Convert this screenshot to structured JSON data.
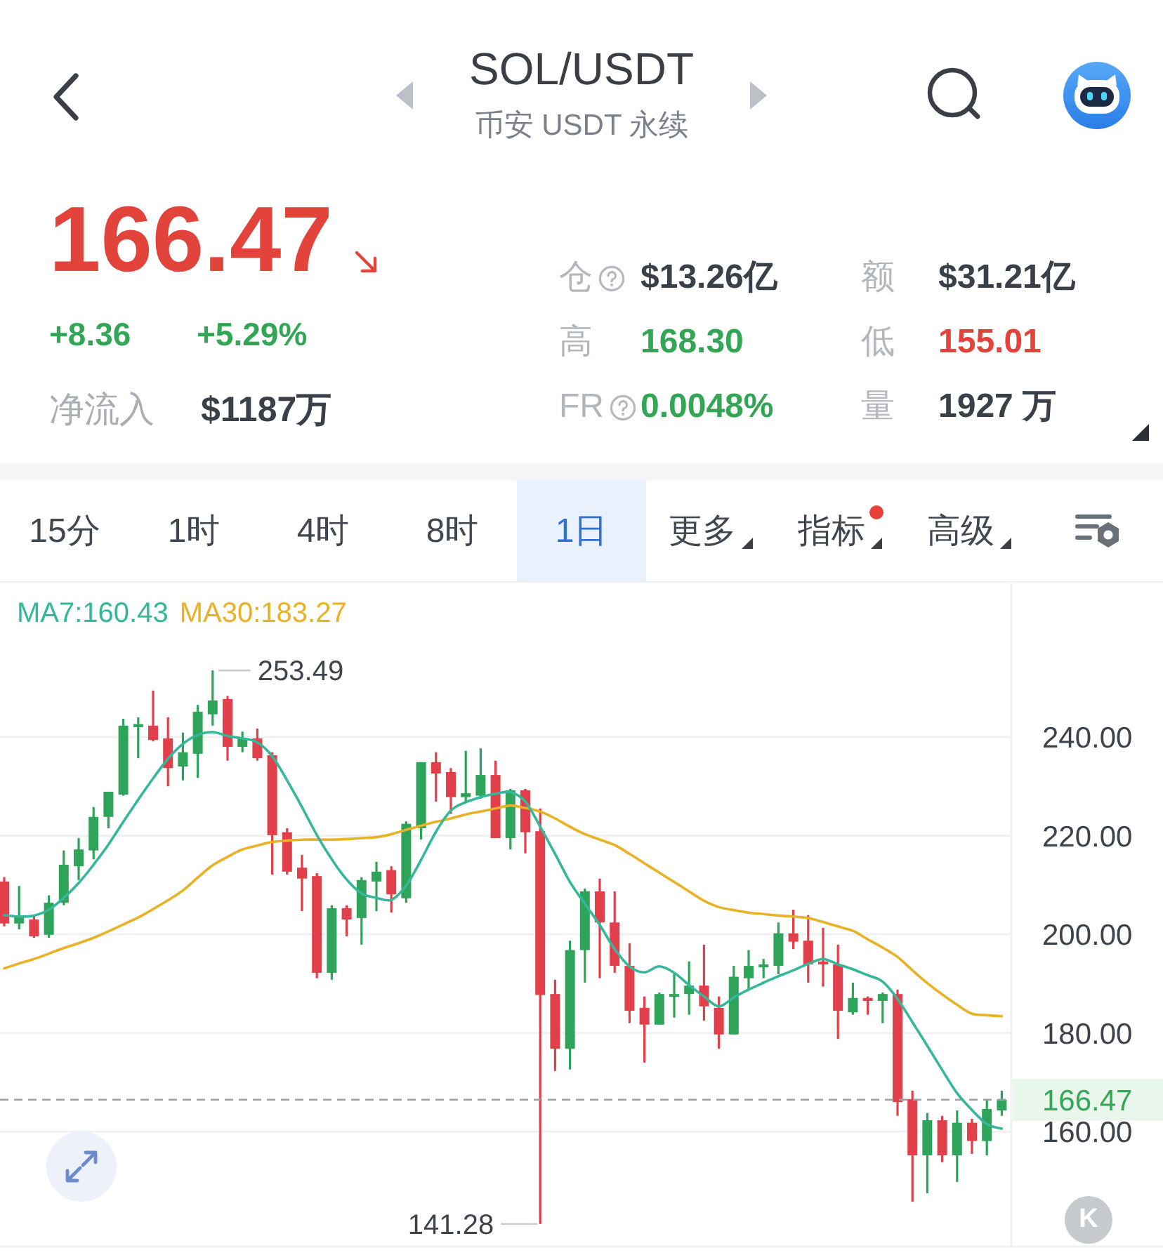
{
  "header": {
    "title": "SOL/USDT",
    "subtitle": "币安 USDT 永续"
  },
  "ticker": {
    "price": "166.47",
    "price_falling": true,
    "change": "+8.36",
    "change_percent": "+5.29%",
    "change_positive": true,
    "net_inflow": {
      "label": "净流入",
      "value": "$1187万"
    }
  },
  "stats": [
    {
      "label": "仓",
      "info": true,
      "value": "$13.26亿",
      "color": "#3a4048"
    },
    {
      "label": "额",
      "info": false,
      "value": "$31.21亿",
      "color": "#3a4048"
    },
    {
      "label": "高",
      "info": false,
      "value": "168.30",
      "color": "#33a655"
    },
    {
      "label": "低",
      "info": false,
      "value": "155.01",
      "color": "#e2433b"
    },
    {
      "label": "FR",
      "info": true,
      "value": "0.0048%",
      "color": "#33a655"
    },
    {
      "label": "量",
      "info": false,
      "value": "1927 万",
      "color": "#3a4048"
    }
  ],
  "intervals": [
    {
      "label": "15分",
      "selected": false,
      "dropdown": false,
      "badge": false
    },
    {
      "label": "1时",
      "selected": false,
      "dropdown": false,
      "badge": false
    },
    {
      "label": "4时",
      "selected": false,
      "dropdown": false,
      "badge": false
    },
    {
      "label": "8时",
      "selected": false,
      "dropdown": false,
      "badge": false
    },
    {
      "label": "1日",
      "selected": true,
      "dropdown": false,
      "badge": false
    },
    {
      "label": "更多",
      "selected": false,
      "dropdown": true,
      "badge": false
    },
    {
      "label": "指标",
      "selected": false,
      "dropdown": true,
      "badge": true
    },
    {
      "label": "高级",
      "selected": false,
      "dropdown": true,
      "badge": false
    }
  ],
  "chart": {
    "chart_data": {
      "type": "candlestick",
      "grid": true,
      "ylim": [
        136.7,
        271.3
      ],
      "yticks": [
        {
          "value": 240,
          "label": "240.00"
        },
        {
          "value": 200,
          "label": "200.00"
        },
        {
          "value": 160,
          "label": "160.00"
        }
      ],
      "ohlc": [
        [
          210.7,
          211.6,
          201.6,
          202.2
        ],
        [
          202.2,
          209.8,
          201.0,
          203.6
        ],
        [
          203.0,
          203.6,
          199.3,
          199.6
        ],
        [
          199.9,
          207.9,
          199.3,
          206.4
        ],
        [
          206.4,
          217.0,
          205.9,
          214.1
        ],
        [
          213.8,
          219.5,
          211.0,
          217.2
        ],
        [
          217.0,
          225.8,
          215.2,
          223.8
        ],
        [
          223.8,
          228.9,
          221.5,
          228.9
        ],
        [
          228.3,
          243.7,
          228.1,
          242.3
        ],
        [
          242.0,
          244.0,
          235.7,
          242.6
        ],
        [
          242.3,
          249.4,
          239.1,
          239.4
        ],
        [
          239.7,
          244.0,
          230.0,
          233.7
        ],
        [
          234.0,
          240.9,
          231.2,
          236.9
        ],
        [
          236.6,
          246.5,
          231.7,
          245.1
        ],
        [
          244.6,
          253.49,
          242.3,
          247.4
        ],
        [
          247.7,
          248.3,
          235.2,
          238.0
        ],
        [
          238.0,
          241.1,
          236.9,
          239.7
        ],
        [
          239.7,
          241.7,
          235.2,
          235.7
        ],
        [
          236.3,
          236.9,
          212.1,
          220.1
        ],
        [
          220.7,
          221.5,
          212.1,
          212.7
        ],
        [
          213.5,
          216.1,
          204.7,
          211.3
        ],
        [
          211.8,
          212.4,
          191.1,
          192.2
        ],
        [
          192.2,
          205.9,
          190.8,
          205.3
        ],
        [
          205.3,
          205.9,
          199.6,
          203.0
        ],
        [
          203.3,
          211.6,
          197.9,
          211.0
        ],
        [
          210.7,
          214.7,
          204.7,
          212.7
        ],
        [
          213.0,
          213.8,
          204.4,
          208.1
        ],
        [
          207.3,
          222.9,
          206.4,
          222.4
        ],
        [
          221.5,
          234.9,
          219.2,
          234.9
        ],
        [
          234.9,
          236.9,
          226.9,
          232.6
        ],
        [
          232.9,
          233.7,
          224.4,
          227.8
        ],
        [
          227.8,
          237.2,
          226.6,
          228.6
        ],
        [
          228.1,
          237.7,
          227.5,
          232.3
        ],
        [
          232.3,
          235.2,
          219.5,
          219.5
        ],
        [
          219.5,
          229.5,
          217.2,
          229.2
        ],
        [
          229.2,
          229.5,
          216.4,
          220.7
        ],
        [
          220.9,
          225.5,
          141.28,
          187.7
        ],
        [
          187.9,
          190.8,
          172.3,
          176.8
        ],
        [
          176.8,
          198.7,
          172.6,
          196.8
        ],
        [
          196.8,
          209.3,
          190.2,
          208.7
        ],
        [
          208.7,
          211.3,
          191.1,
          202.4
        ],
        [
          202.4,
          208.7,
          192.2,
          193.6
        ],
        [
          193.6,
          198.2,
          182.0,
          184.5
        ],
        [
          185.1,
          187.4,
          174.0,
          181.7
        ],
        [
          181.7,
          188.2,
          181.7,
          187.9
        ],
        [
          187.4,
          192.2,
          183.1,
          187.9
        ],
        [
          187.9,
          194.5,
          183.7,
          189.6
        ],
        [
          189.6,
          197.9,
          182.5,
          185.4
        ],
        [
          185.1,
          187.4,
          176.8,
          179.7
        ],
        [
          179.7,
          193.6,
          179.7,
          191.4
        ],
        [
          191.1,
          196.8,
          188.8,
          193.6
        ],
        [
          193.3,
          195.0,
          191.1,
          193.9
        ],
        [
          193.6,
          202.4,
          191.9,
          200.2
        ],
        [
          200.2,
          205.0,
          197.0,
          198.5
        ],
        [
          198.7,
          203.9,
          190.2,
          193.9
        ],
        [
          194.5,
          201.3,
          189.4,
          193.9
        ],
        [
          193.9,
          197.9,
          178.8,
          184.5
        ],
        [
          184.2,
          190.2,
          183.7,
          187.1
        ],
        [
          187.1,
          187.4,
          183.7,
          186.5
        ],
        [
          186.5,
          188.2,
          182.0,
          187.9
        ],
        [
          187.9,
          188.8,
          163.2,
          166.0
        ],
        [
          166.6,
          168.3,
          145.8,
          155.2
        ],
        [
          155.2,
          163.8,
          147.5,
          162.3
        ],
        [
          162.3,
          163.2,
          153.8,
          155.2
        ],
        [
          155.2,
          164.3,
          149.8,
          161.8
        ],
        [
          161.8,
          162.6,
          155.5,
          158.1
        ],
        [
          158.1,
          166.6,
          155.2,
          164.6
        ],
        [
          164.3,
          168.3,
          163.2,
          166.47
        ]
      ],
      "ref_lines": [
        {
          "axis": "y",
          "value": 166.47,
          "label": "166.47"
        }
      ],
      "annotations": [
        "253.49",
        "141.28"
      ]
    },
    "moving_averages": {
      "chart_data": {
        "type": "line",
        "ylim": [
          136.7,
          271.3
        ],
        "yticks": [
          {
            "value": 220,
            "label": "220.00"
          },
          {
            "value": 180,
            "label": "180.00"
          }
        ],
        "series": [
          {
            "name": "MA7:160.43",
            "color": "#35b89a",
            "values": [
              203.9,
              203.6,
              203.8,
              205.0,
              207.4,
              210.4,
              214.1,
              218.2,
              222.8,
              227.3,
              231.6,
              235.6,
              238.6,
              240.4,
              241.0,
              240.2,
              239.7,
              238.9,
              236.1,
              231.2,
              225.8,
              220.1,
              215.2,
              211.1,
              208.3,
              207.4,
              207.0,
              209.9,
              215.1,
              220.8,
              225.1,
              226.8,
              227.8,
              228.5,
              228.8,
              226.9,
              221.8,
              216.3,
              210.6,
              206.2,
              201.9,
              197.0,
              193.5,
              192.3,
              193.5,
              192.2,
              189.7,
              187.4,
              185.4,
              187.2,
              188.8,
              190.2,
              191.5,
              192.7,
              194.0,
              195.0,
              193.9,
              192.9,
              191.7,
              190.4,
              186.9,
              182.2,
              177.4,
              172.5,
              167.8,
              164.4,
              161.5,
              160.6
            ]
          },
          {
            "name": "MA30:183.27",
            "color": "#e9b124",
            "values": [
              193.1,
              194.1,
              195.0,
              196.1,
              197.2,
              198.2,
              199.3,
              200.6,
              202.0,
              203.4,
              205.1,
              206.9,
              208.9,
              211.5,
              214.0,
              215.7,
              217.2,
              218.0,
              218.7,
              219.0,
              219.2,
              219.2,
              219.2,
              219.3,
              219.5,
              219.7,
              220.3,
              221.2,
              222.0,
              222.8,
              223.5,
              224.3,
              224.9,
              225.5,
              226.1,
              225.6,
              224.9,
              223.5,
              221.8,
              220.3,
              219.2,
              218.1,
              216.3,
              214.4,
              212.5,
              210.6,
              208.7,
              206.8,
              205.5,
              204.9,
              204.4,
              204.1,
              203.8,
              203.6,
              203.3,
              202.5,
              201.6,
              200.7,
              199.0,
              197.3,
              195.4,
              192.7,
              190.1,
              187.8,
              185.7,
              183.9,
              183.6,
              183.4
            ]
          }
        ]
      }
    },
    "k_button": "K"
  }
}
